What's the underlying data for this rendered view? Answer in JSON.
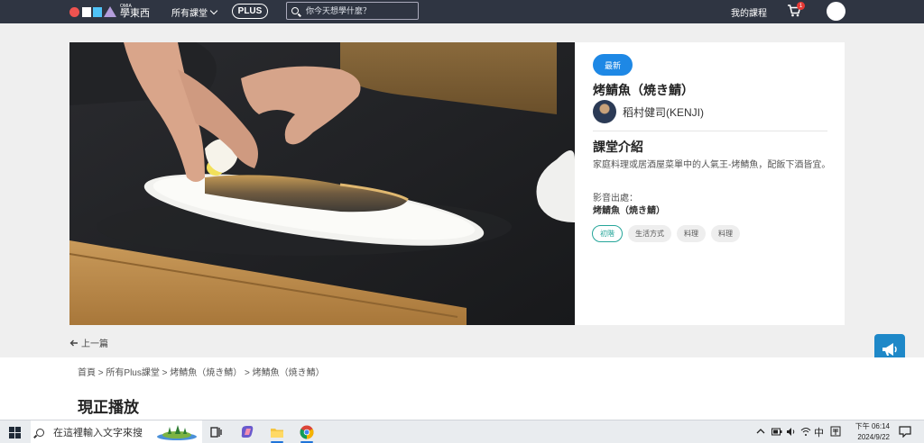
{
  "nav": {
    "brand_small": "OMIA",
    "brand_big": "學東西",
    "all_courses": "所有課堂",
    "plus": "PLUS",
    "search_placeholder": "你今天想學什麼？",
    "my_courses": "我的課程",
    "cart_count": "1",
    "icons": {
      "search": "search-icon",
      "cart": "cart-icon",
      "chevron": "chevron-down-icon"
    }
  },
  "course": {
    "badge": "最新",
    "title": "烤鯖魚（焼き鯖）",
    "teacher": "稻村健司(KENJI)",
    "intro_heading": "課堂介紹",
    "intro_text": "家庭料理或居酒屋菜單中的人氣王-烤鯖魚，配飯下酒皆宜。",
    "source_label": "影音出處：",
    "source_value": "烤鯖魚（焼き鯖）",
    "tags": [
      "初階",
      "生活方式",
      "料理",
      "料理"
    ]
  },
  "nav_prev": "上一篇",
  "breadcrumb": {
    "items": [
      "首頁",
      "所有Plus課堂",
      "烤鯖魚（焼き鯖）",
      "烤鯖魚（焼き鯖）"
    ],
    "separator": " > "
  },
  "now_playing": "現正播放",
  "taskbar": {
    "search_text": "在這裡輸入文字來搜",
    "ime": "中",
    "time_period": "下午 06:14",
    "date": "2024/9/22"
  },
  "colors": {
    "nav_bg": "#2f3542",
    "accent_blue": "#1e88e5",
    "tag_level": "#26a69a",
    "cart_badge": "#e53935"
  }
}
